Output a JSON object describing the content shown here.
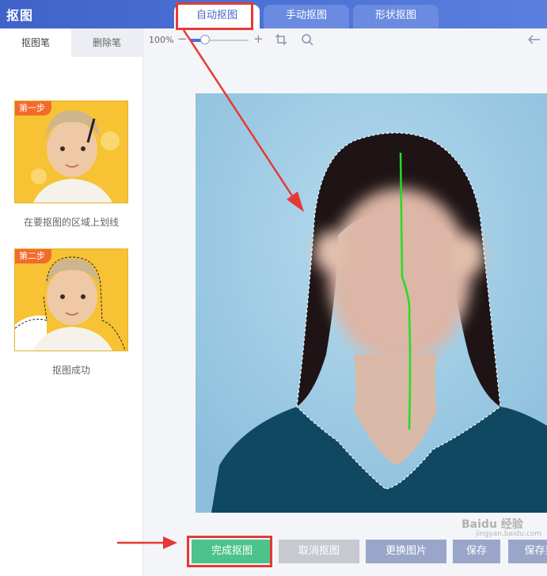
{
  "header": {
    "app_title": "抠图",
    "tabs": [
      {
        "label": "自动抠图",
        "active": true
      },
      {
        "label": "手动抠图",
        "active": false
      },
      {
        "label": "形状抠图",
        "active": false
      }
    ]
  },
  "left_panel": {
    "tabs": [
      {
        "label": "抠图笔",
        "active": true
      },
      {
        "label": "删除笔",
        "active": false
      }
    ],
    "steps": [
      {
        "badge": "第一步",
        "caption": "在要抠图的区域上划线"
      },
      {
        "badge": "第二步",
        "caption": "抠图成功"
      }
    ]
  },
  "toolbar": {
    "zoom_level": "100%",
    "zoom_minus": "−",
    "zoom_plus": "+",
    "zoom_fraction": 0.25,
    "icons": [
      "crop-fit-icon",
      "magnifier-icon",
      "back-arrow-icon"
    ]
  },
  "actions": {
    "done": "完成抠图",
    "cancel": "取消抠图",
    "replace": "更换图片",
    "save": "保存",
    "save_to": "保存到"
  },
  "watermark": {
    "text": "Baidu 经验",
    "sub": "jingyan.baidu.com"
  },
  "colors": {
    "header": "#4766c8",
    "done_button": "#4cc38a",
    "annotation": "#e53935",
    "stroke_line": "#22dd22"
  }
}
